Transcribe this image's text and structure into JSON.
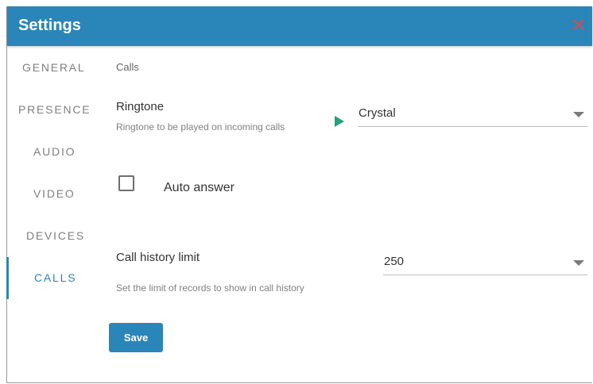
{
  "dialog": {
    "title": "Settings",
    "close_icon": "close-icon"
  },
  "nav": {
    "items": [
      {
        "label": "GENERAL",
        "active": false
      },
      {
        "label": "PRESENCE",
        "active": false
      },
      {
        "label": "AUDIO",
        "active": false
      },
      {
        "label": "VIDEO",
        "active": false
      },
      {
        "label": "DEVICES",
        "active": false
      },
      {
        "label": "CALLS",
        "active": true
      }
    ]
  },
  "calls": {
    "section_title": "Calls",
    "ringtone": {
      "label": "Ringtone",
      "description": "Ringtone to be played on incoming calls",
      "value": "Crystal",
      "play_icon": "play-icon"
    },
    "auto_answer": {
      "label": "Auto answer",
      "checked": false
    },
    "history_limit": {
      "label": "Call history limit",
      "description": "Set the limit of records to show in call history",
      "value": "250"
    },
    "save_label": "Save"
  },
  "colors": {
    "accent": "#2a86b8",
    "close": "#e04848",
    "play": "#21a37b"
  }
}
